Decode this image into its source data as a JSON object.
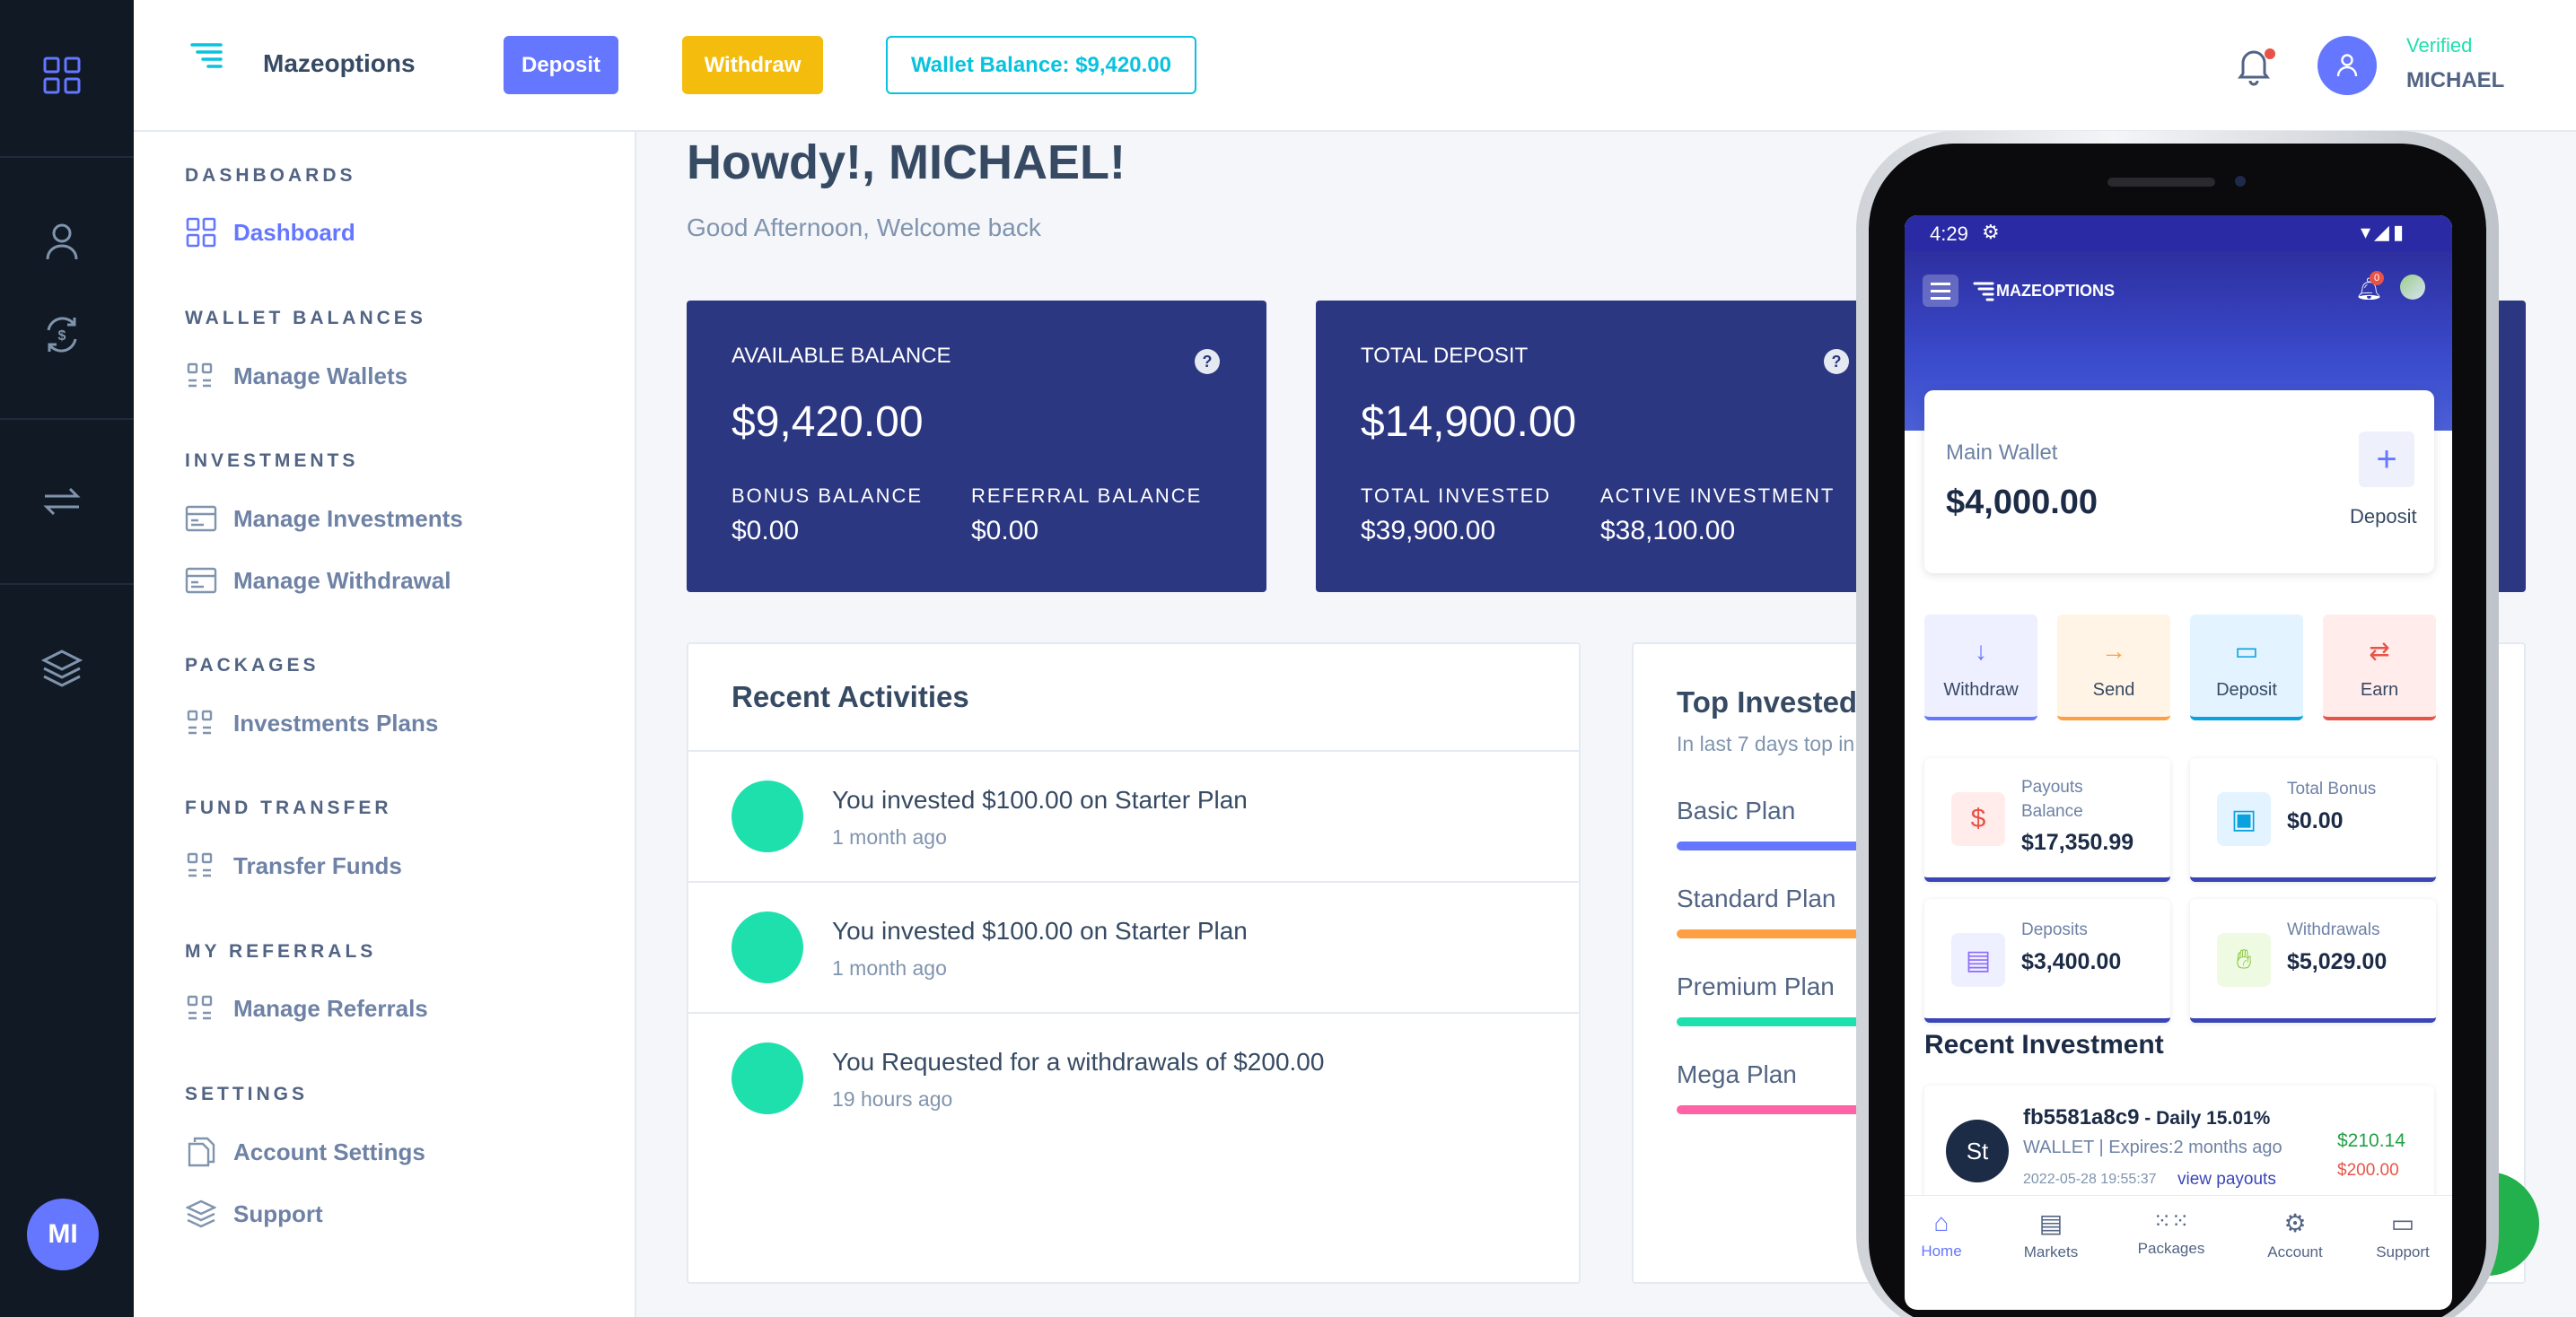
{
  "app": {
    "brand": "Mazeoptions",
    "mobile_brand": "MAZEOPTIONS"
  },
  "header": {
    "deposit_label": "Deposit",
    "withdraw_label": "Withdraw",
    "wallet_balance_label": "Wallet Balance: $9,420.00",
    "verified_label": "Verified",
    "username": "MICHAEL",
    "notification_icon": "bell-icon",
    "user_icon": "user-icon"
  },
  "rail": {
    "icons": [
      "dashboard-grid-icon",
      "user-icon",
      "exchange-dollar-icon",
      "transfer-arrows-icon",
      "layers-icon"
    ],
    "avatar_initials": "MI"
  },
  "sidebar": {
    "sections": [
      {
        "title": "DASHBOARDS",
        "items": [
          {
            "label": "Dashboard",
            "icon": "dashboard-grid-icon",
            "active": true
          }
        ]
      },
      {
        "title": "WALLET BALANCES",
        "items": [
          {
            "label": "Manage Wallets",
            "icon": "grid-list-icon"
          }
        ]
      },
      {
        "title": "INVESTMENTS",
        "items": [
          {
            "label": "Manage Investments",
            "icon": "card-icon"
          },
          {
            "label": "Manage Withdrawal",
            "icon": "card-icon"
          }
        ]
      },
      {
        "title": "PACKAGES",
        "items": [
          {
            "label": "Investments Plans",
            "icon": "grid-list-icon"
          }
        ]
      },
      {
        "title": "FUND TRANSFER",
        "items": [
          {
            "label": "Transfer Funds",
            "icon": "grid-list-icon"
          }
        ]
      },
      {
        "title": "MY REFERRALS",
        "items": [
          {
            "label": "Manage Referrals",
            "icon": "grid-list-icon"
          }
        ]
      },
      {
        "title": "SETTINGS",
        "items": [
          {
            "label": "Account Settings",
            "icon": "documents-icon"
          },
          {
            "label": "Support",
            "icon": "layers-icon"
          }
        ]
      }
    ]
  },
  "main": {
    "greeting": "Howdy!, MICHAEL!",
    "subgreeting": "Good Afternoon, Welcome back",
    "cards": [
      {
        "title": "AVAILABLE BALANCE",
        "value": "$9,420.00",
        "sub": [
          {
            "label": "BONUS BALANCE",
            "value": "$0.00"
          },
          {
            "label": "REFERRAL BALANCE",
            "value": "$0.00"
          }
        ]
      },
      {
        "title": "TOTAL DEPOSIT",
        "value": "$14,900.00",
        "sub": [
          {
            "label": "TOTAL INVESTED",
            "value": "$39,900.00"
          },
          {
            "label": "ACTIVE INVESTMENT",
            "value": "$38,100.00"
          }
        ]
      }
    ],
    "help_glyph": "?",
    "recent_activities": {
      "title": "Recent Activities",
      "items": [
        {
          "text": "You invested $100.00 on Starter Plan",
          "time": "1 month ago"
        },
        {
          "text": "You invested $100.00 on Starter Plan",
          "time": "1 month ago"
        },
        {
          "text": "You Requested for a withdrawals of $200.00",
          "time": "19 hours ago"
        }
      ]
    },
    "top_invested": {
      "title": "Top Invested I",
      "subtitle": "In last 7 days top in",
      "plans": [
        {
          "name": "Basic Plan",
          "color": "#6576ff"
        },
        {
          "name": "Standard Plan",
          "color": "#ff9f43"
        },
        {
          "name": "Premium Plan",
          "color": "#1ee0ac"
        },
        {
          "name": "Mega Plan",
          "color": "#ff63a5"
        }
      ]
    }
  },
  "phone": {
    "status_time": "4:29",
    "notification_count": "0",
    "wallet": {
      "label": "Main Wallet",
      "value": "$4,000.00",
      "action": "Deposit",
      "plus": "+"
    },
    "quick_actions": [
      {
        "label": "Withdraw",
        "glyph": "↓",
        "bg": "#eeefff",
        "color": "#6576ff"
      },
      {
        "label": "Send",
        "glyph": "→",
        "bg": "#fff4e6",
        "color": "#ff9f43"
      },
      {
        "label": "Deposit",
        "glyph": "▭",
        "bg": "#e3f3ff",
        "color": "#09a2de"
      },
      {
        "label": "Earn",
        "glyph": "⇄",
        "bg": "#ffeceb",
        "color": "#e85347"
      }
    ],
    "stats": [
      {
        "label_line1": "Payouts",
        "label_line2": "Balance",
        "value": "$17,350.99",
        "icon": "money-bag-icon",
        "bg": "#ffeceb",
        "color": "#e85347"
      },
      {
        "label_line1": "Total Bonus",
        "label_line2": "",
        "value": "$0.00",
        "icon": "bonus-card-icon",
        "bg": "#e3f3ff",
        "color": "#09a2de"
      },
      {
        "label_line1": "Deposits",
        "label_line2": "",
        "value": "$3,400.00",
        "icon": "receipt-icon",
        "bg": "#eeefff",
        "color": "#8e6bff"
      },
      {
        "label_line1": "Withdrawals",
        "label_line2": "",
        "value": "$5,029.00",
        "icon": "cash-hand-icon",
        "bg": "#effae3",
        "color": "#8cc63f"
      }
    ],
    "recent_investment": {
      "title": "Recent Investment",
      "id": "fb5581a8c9",
      "rate": " - Daily 15.01%",
      "meta": "WALLET | Expires:2 months ago",
      "date": "2022-05-28 19:55:37",
      "link": "view payouts",
      "amount_up": "$210.14",
      "amount_down": "$200.00",
      "avatar": "St"
    },
    "tabs": [
      {
        "label": "Home",
        "icon": "home-icon",
        "active": true
      },
      {
        "label": "Markets",
        "icon": "receipt-icon"
      },
      {
        "label": "Packages",
        "icon": "grid-dots-icon"
      },
      {
        "label": "Account",
        "icon": "gear-icon"
      },
      {
        "label": "Support",
        "icon": "card-icon"
      }
    ]
  }
}
